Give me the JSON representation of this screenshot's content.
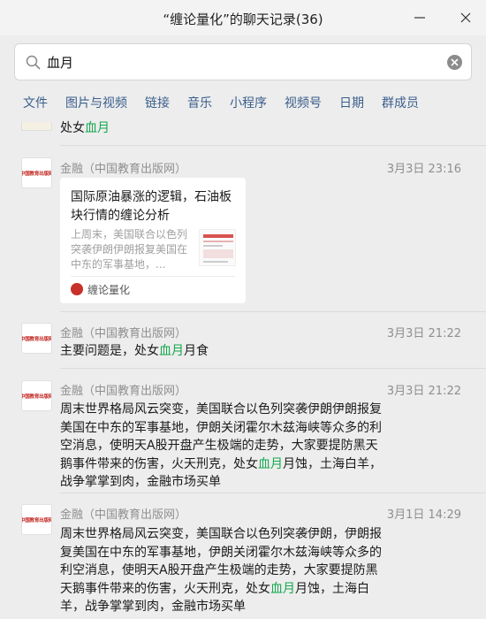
{
  "window": {
    "title": "“缠论量化”的聊天记录(36)",
    "minimize_icon": "minimize-icon",
    "close_icon": "close-icon"
  },
  "search": {
    "value": "血月",
    "search_icon": "search-icon",
    "clear_icon": "clear-icon"
  },
  "tabs": [
    "文件",
    "图片与视频",
    "链接",
    "音乐",
    "小程序",
    "视频号",
    "日期",
    "群成员"
  ],
  "colors": {
    "highlight": "#12a84c",
    "tab": "#3a5e8c",
    "meta": "#8f8f8f",
    "background": "#ededed"
  },
  "messages": [
    {
      "partial": true,
      "text_before": "处女",
      "keyword": "血月",
      "text_after": ""
    },
    {
      "sender": "金融（中国教育出版网）",
      "time": "3月3日 23:16",
      "card": {
        "title": "国际原油暴涨的逻辑，石油板块行情的缠论分析",
        "desc": "上周末，美国联合以色列突袭伊朗伊朗报复美国在中东的军事基地，...",
        "source": "缠论量化"
      }
    },
    {
      "sender": "金融（中国教育出版网）",
      "time": "3月3日 21:22",
      "text_before": "主要问题是，处女",
      "keyword": "血月",
      "text_after": "月食"
    },
    {
      "sender": "金融（中国教育出版网）",
      "time": "3月3日 21:22",
      "text_before": "周末世界格局风云突变，美国联合以色列突袭伊朗伊朗报复美国在中东的军事基地，伊朗关闭霍尔木兹海峡等众多的利空消息，使明天A股开盘产生极端的走势，大家要提防黑天鹅事件带来的伤害，火天刑克，处女",
      "keyword": "血月",
      "text_after": "月蚀，土海白羊，战争掌掌到肉，金融市场买单"
    },
    {
      "sender": "金融（中国教育出版网）",
      "time": "3月1日 14:29",
      "text_before": "周末世界格局风云突变，美国联合以色列突袭伊朗，伊朗报复美国在中东的军事基地，伊朗关闭霍尔木兹海峡等众多的利空消息，使明天A股开盘产生极端的走势，大家要提防黑天鹅事件带来的伤害，火天刑克，处女",
      "keyword": "血月",
      "text_after": "月蚀，土海白羊，战争掌掌到肉，金融市场买单"
    }
  ],
  "avatar_label": "中国教育出版网"
}
